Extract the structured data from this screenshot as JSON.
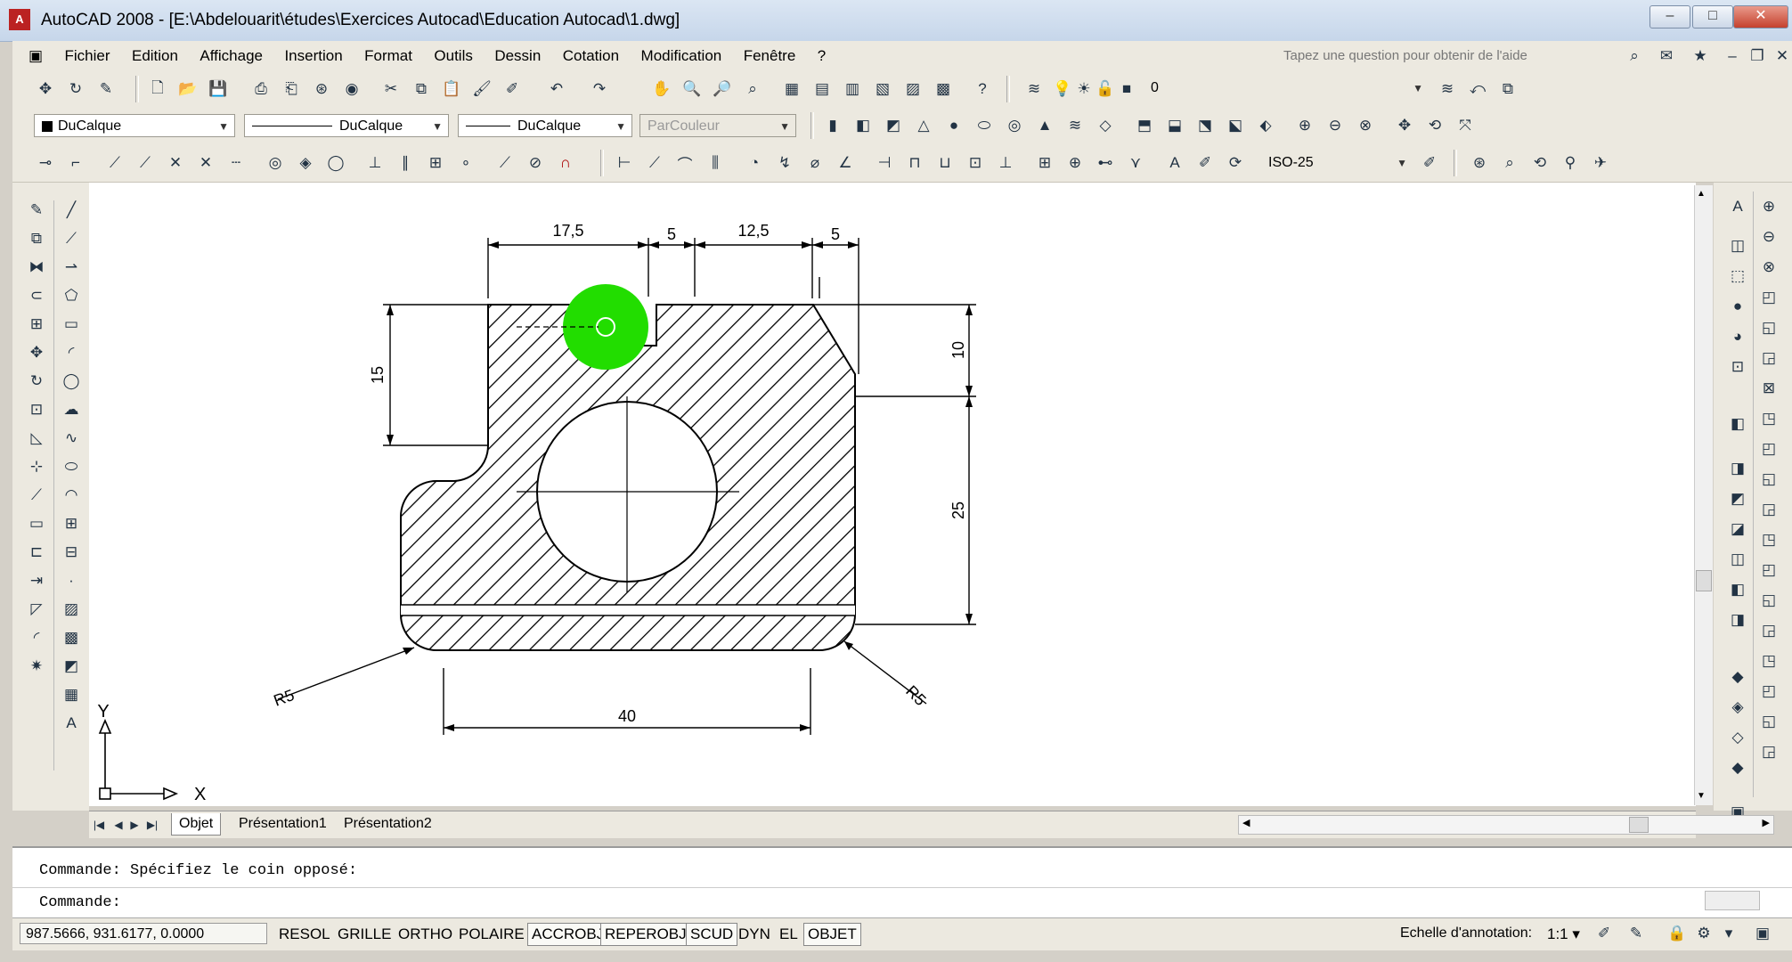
{
  "window": {
    "title": "AutoCAD 2008 - [E:\\Abdelouarit\\études\\Exercices Autocad\\Education Autocad\\1.dwg]",
    "app_icon_text": "A"
  },
  "menu": {
    "items": [
      "Fichier",
      "Edition",
      "Affichage",
      "Insertion",
      "Format",
      "Outils",
      "Dessin",
      "Cotation",
      "Modification",
      "Fenêtre",
      "?"
    ],
    "help_placeholder": "Tapez une question pour obtenir de l'aide"
  },
  "toolbar": {
    "layer_value": "0",
    "color_value": "DuCalque",
    "linetype_value": "DuCalque",
    "lineweight_value": "DuCalque",
    "plotstyle_value": "ParCouleur",
    "dimstyle_value": "ISO-25"
  },
  "drawing": {
    "dimensions": {
      "top_1": "17,5",
      "top_2": "5",
      "top_3": "12,5",
      "top_4": "5",
      "left_height": "15",
      "right_top": "10",
      "right_height": "25",
      "bottom_width": "40",
      "radius_left": "R5",
      "radius_right": "R5"
    },
    "ucs": {
      "x_label": "X",
      "y_label": "Y"
    },
    "highlight_color": "#22dd00"
  },
  "tabs": {
    "items": [
      "Objet",
      "Présentation1",
      "Présentation2"
    ],
    "active": "Objet"
  },
  "command": {
    "history": "Commande: Spécifiez le coin opposé:",
    "prompt": "Commande:"
  },
  "status": {
    "coordinates": "987.5666, 931.6177, 0.0000",
    "buttons": [
      "RESOL",
      "GRILLE",
      "ORTHO",
      "POLAIRE",
      "ACCROBJ",
      "REPEROBJ",
      "SCUD",
      "DYN",
      "EL",
      "OBJET"
    ],
    "on_buttons": [
      "ACCROBJ",
      "REPEROBJ",
      "SCUD",
      "OBJET"
    ],
    "annotation_scale_label": "Echelle d'annotation:",
    "annotation_scale_value": "1:1"
  }
}
